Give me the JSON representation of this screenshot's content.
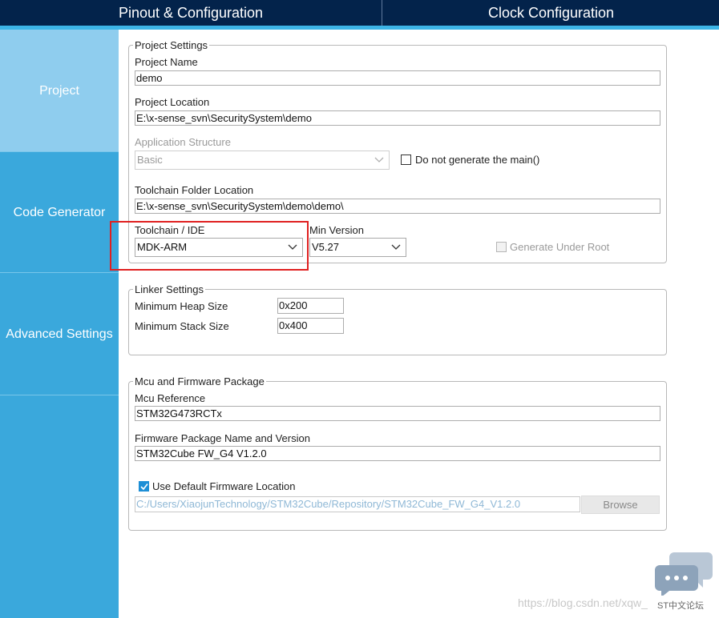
{
  "tabs": {
    "pinout": "Pinout & Configuration",
    "clock": "Clock Configuration"
  },
  "sidebar": {
    "items": [
      {
        "label": "Project",
        "active": true
      },
      {
        "label": "Code Generator",
        "active": false
      },
      {
        "label": "Advanced Settings",
        "active": false
      }
    ]
  },
  "project_settings": {
    "legend": "Project Settings",
    "project_name_label": "Project Name",
    "project_name_value": "demo",
    "project_location_label": "Project Location",
    "project_location_value": "E:\\x-sense_svn\\SecuritySystem\\demo",
    "app_structure_label": "Application Structure",
    "app_structure_value": "Basic",
    "no_main_label": "Do not generate the main()",
    "no_main_checked": false,
    "toolchain_folder_label": "Toolchain Folder Location",
    "toolchain_folder_value": "E:\\x-sense_svn\\SecuritySystem\\demo\\demo\\",
    "toolchain_ide_label": "Toolchain / IDE",
    "toolchain_ide_value": "MDK-ARM",
    "min_version_label": "Min Version",
    "min_version_value": "V5.27",
    "generate_under_root_label": "Generate Under Root",
    "generate_under_root_checked": false
  },
  "linker_settings": {
    "legend": "Linker Settings",
    "min_heap_label": "Minimum Heap Size",
    "min_heap_value": "0x200",
    "min_stack_label": "Minimum Stack Size",
    "min_stack_value": "0x400"
  },
  "mcu_firmware": {
    "legend": "Mcu and Firmware Package",
    "mcu_ref_label": "Mcu Reference",
    "mcu_ref_value": "STM32G473RCTx",
    "fw_pkg_label": "Firmware Package Name and Version",
    "fw_pkg_value": "STM32Cube FW_G4 V1.2.0",
    "use_default_label": "Use Default Firmware Location",
    "use_default_checked": true,
    "fw_location_value": "C:/Users/XiaojunTechnology/STM32Cube/Repository/STM32Cube_FW_G4_V1.2.0",
    "browse_label": "Browse"
  },
  "watermark": "https://blog.csdn.net/xqw_",
  "forum_label": "ST中文论坛",
  "colors": {
    "tabbar": "#03234b",
    "accent": "#3cb4e6",
    "sidebar": "#3aa8dc",
    "sidebar_active": "#8fcdee",
    "highlight": "#e02020",
    "checkbox_checked": "#1e8fd6"
  }
}
